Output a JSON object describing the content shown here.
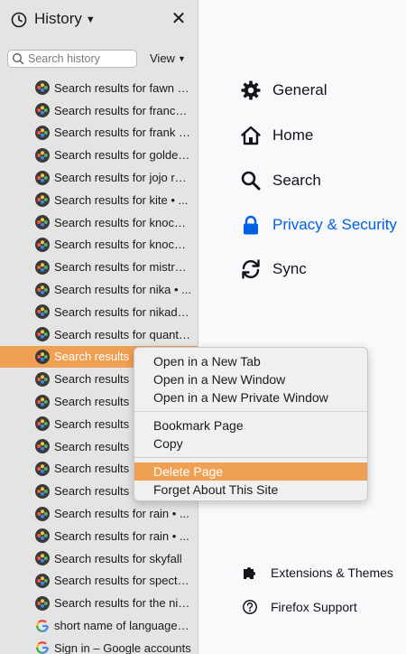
{
  "sidebar": {
    "title": "History",
    "close_glyph": "✕",
    "search_placeholder": "Search history",
    "view_label": "View",
    "items": [
      {
        "text": "Search results for fawn eyes",
        "icon": "colored-dots-favicon"
      },
      {
        "text": "Search results for francesca",
        "icon": "colored-dots-favicon"
      },
      {
        "text": "Search results for frank ocean",
        "icon": "colored-dots-favicon"
      },
      {
        "text": "Search results for golden hour",
        "icon": "colored-dots-favicon"
      },
      {
        "text": "Search results for jojo rabbit",
        "icon": "colored-dots-favicon"
      },
      {
        "text": "Search results for kite • ...",
        "icon": "colored-dots-favicon"
      },
      {
        "text": "Search results for knockin on heavens door",
        "icon": "colored-dots-favicon"
      },
      {
        "text": "Search results for knocked loose",
        "icon": "colored-dots-favicon"
      },
      {
        "text": "Search results for mistress",
        "icon": "colored-dots-favicon"
      },
      {
        "text": "Search results for nika • ...",
        "icon": "colored-dots-favicon"
      },
      {
        "text": "Search results for nikadorable",
        "icon": "colored-dots-favicon"
      },
      {
        "text": "Search results for quantum",
        "icon": "colored-dots-favicon"
      },
      {
        "text": "Search results",
        "icon": "colored-dots-favicon",
        "selected": true
      },
      {
        "text": "Search results",
        "icon": "colored-dots-favicon"
      },
      {
        "text": "Search results",
        "icon": "colored-dots-favicon"
      },
      {
        "text": "Search results",
        "icon": "colored-dots-favicon"
      },
      {
        "text": "Search results",
        "icon": "colored-dots-favicon"
      },
      {
        "text": "Search results",
        "icon": "colored-dots-favicon"
      },
      {
        "text": "Search results",
        "icon": "colored-dots-favicon"
      },
      {
        "text": "Search results for rain • ...",
        "icon": "colored-dots-favicon"
      },
      {
        "text": "Search results for rain • ...",
        "icon": "colored-dots-favicon"
      },
      {
        "text": "Search results for skyfall",
        "icon": "colored-dots-favicon"
      },
      {
        "text": "Search results for spectrum",
        "icon": "colored-dots-favicon"
      },
      {
        "text": "Search results for the night",
        "icon": "colored-dots-favicon"
      },
      {
        "text": "short name of language code",
        "icon": "google-favicon"
      },
      {
        "text": "Sign in – Google accounts",
        "icon": "google-favicon"
      }
    ]
  },
  "preferences": {
    "nav": [
      {
        "label": "General",
        "icon": "gear-icon"
      },
      {
        "label": "Home",
        "icon": "home-icon"
      },
      {
        "label": "Search",
        "icon": "search-icon"
      },
      {
        "label": "Privacy & Security",
        "icon": "lock-icon",
        "active": true
      },
      {
        "label": "Sync",
        "icon": "sync-icon"
      }
    ],
    "bottom": [
      {
        "label": "Extensions & Themes",
        "icon": "puzzle-icon"
      },
      {
        "label": "Firefox Support",
        "icon": "help-icon"
      }
    ]
  },
  "context_menu": {
    "groups": [
      [
        "Open in a New Tab",
        "Open in a New Window",
        "Open in a New Private Window"
      ],
      [
        "Bookmark Page",
        "Copy"
      ],
      [
        "Delete Page",
        "Forget About This Site"
      ]
    ],
    "highlighted": "Delete Page"
  },
  "colors": {
    "selection": "#f0a053",
    "accent": "#0061e0",
    "sidebar_bg": "#e4e4e4",
    "content_bg": "#f9f9fb"
  }
}
